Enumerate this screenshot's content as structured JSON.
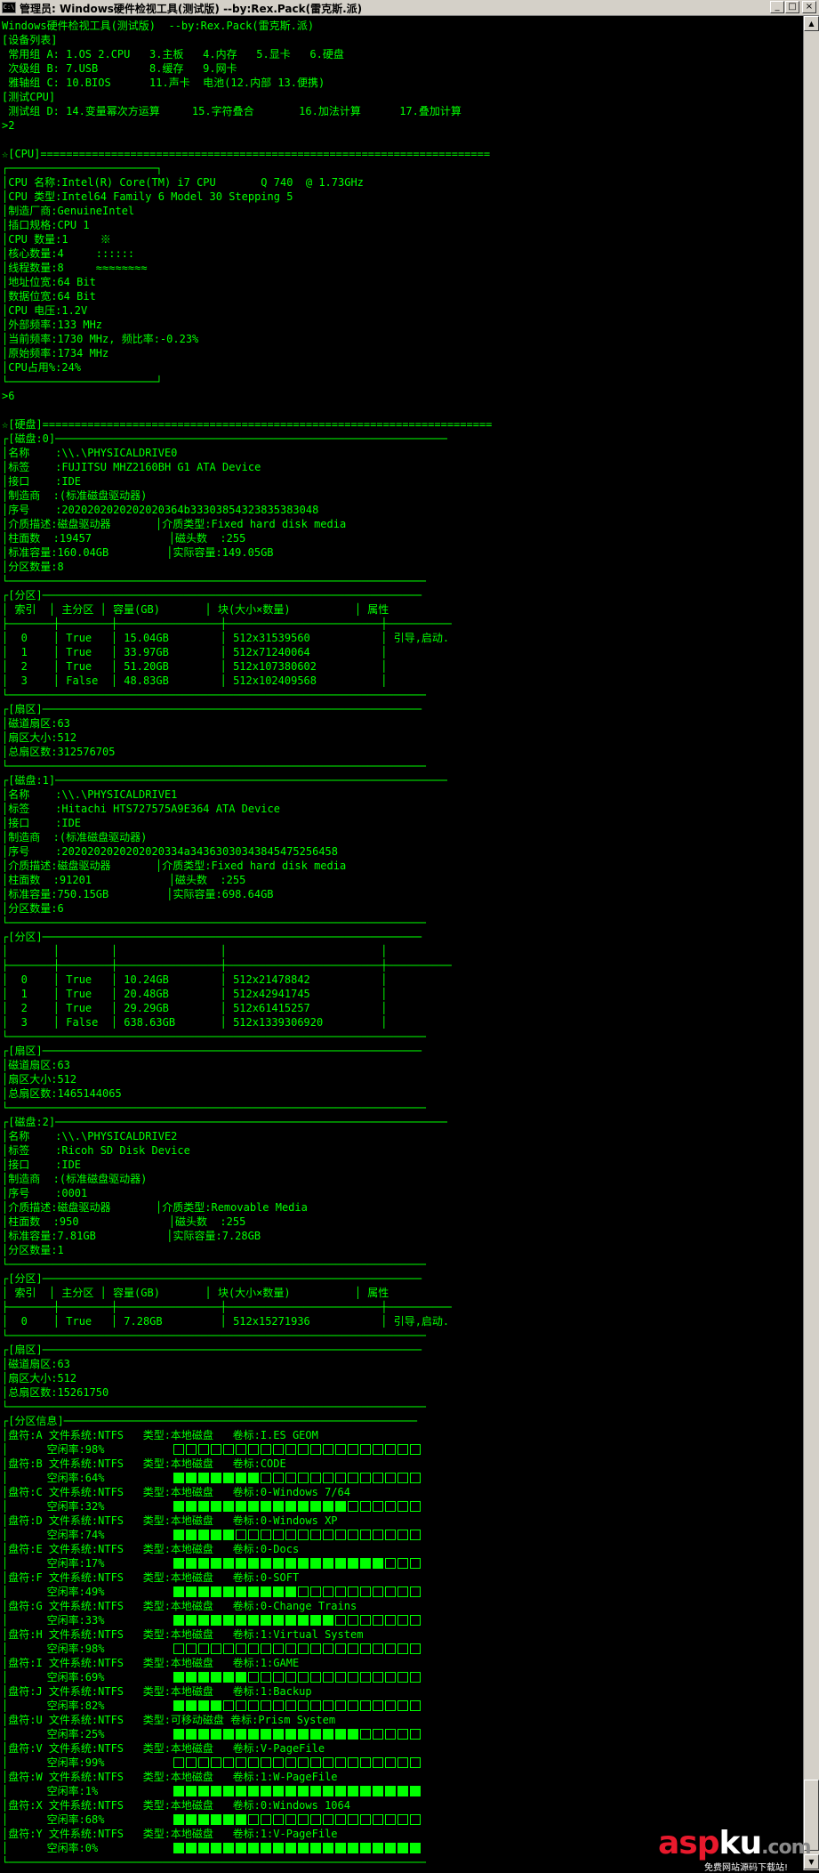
{
  "window": {
    "icon": "C:\\",
    "title": "管理员:  Windows硬件检视工具(测试版)  --by:Rex.Pack(雷克斯.派)",
    "minimize": "_",
    "maximize": "□",
    "close": "×"
  },
  "scrollbar": {
    "up": "▲",
    "down": "▼"
  },
  "console_lines": [
    "Windows硬件检视工具(测试版)  --by:Rex.Pack(雷克斯.派)",
    "[设备列表]",
    " 常用组 A: 1.OS 2.CPU   3.主板   4.内存   5.显卡   6.硬盘",
    " 次级组 B: 7.USB        8.缓存   9.网卡",
    " 雅轴组 C: 10.BIOS      11.声卡  电池(12.内部 13.便携)",
    "[测试CPU]",
    " 测试组 D: 14.变量幂次方运算     15.字符叠合       16.加法计算      17.叠加计算",
    ">2",
    "",
    "☆[CPU]======================================================================",
    "┌───────────────────────┐",
    "│CPU 名称:Intel(R) Core(TM) i7 CPU       Q 740  @ 1.73GHz",
    "│CPU 类型:Intel64 Family 6 Model 30 Stepping 5",
    "│制造厂商:GenuineIntel",
    "│插口规格:CPU 1",
    "│CPU 数量:1     ※",
    "│核心数量:4     ::::::",
    "│线程数量:8     ≈≈≈≈≈≈≈≈",
    "│地址位宽:64 Bit",
    "│数据位宽:64 Bit",
    "│CPU 电压:1.2V",
    "│外部频率:133 MHz",
    "│当前频率:1730 MHz, 频比率:-0.23%",
    "│原始频率:1734 MHz",
    "│CPU占用%:24%",
    "└───────────────────────┘",
    ">6",
    "",
    "☆[硬盘]======================================================================",
    "┌[磁盘:0]─────────────────────────────────────────────────────────────",
    "│名称    :\\\\.\\PHYSICALDRIVE0",
    "│标签    :FUJITSU MHZ2160BH G1 ATA Device",
    "│接口    :IDE",
    "│制造商  :(标准磁盘驱动器)",
    "│序号    :2020202020202020364b33303854323835383048",
    "│介质描述:磁盘驱动器       │介质类型:Fixed hard disk media",
    "│柱面数  :19457            │磁头数  :255",
    "│标准容量:160.04GB         │实际容量:149.05GB",
    "│分区数量:8",
    "└─────────────────────────────────────────────────────────────────",
    "┌[分区]───────────────────────────────────────────────────────────",
    "│ 索引  │ 主分区 │ 容量(GB)       │ 块(大小×数量)          │ 属性",
    "├───────┼────────┼────────────────┼────────────────────────┼──────────",
    "│  0    │ True   │ 15.04GB        │ 512x31539560           │ 引导,启动.",
    "│  1    │ True   │ 33.97GB        │ 512x71240064           │",
    "│  2    │ True   │ 51.20GB        │ 512x107380602          │",
    "│  3    │ False  │ 48.83GB        │ 512x102409568          │",
    "└─────────────────────────────────────────────────────────────────",
    "┌[扇区]───────────────────────────────────────────────────────────",
    "│磁道扇区:63",
    "│扇区大小:512",
    "│总扇区数:312576705",
    "└─────────────────────────────────────────────────────────────────",
    "┌[磁盘:1]─────────────────────────────────────────────────────────────",
    "│名称    :\\\\.\\PHYSICALDRIVE1",
    "│标签    :Hitachi HTS727575A9E364 ATA Device",
    "│接口    :IDE",
    "│制造商  :(标准磁盘驱动器)",
    "│序号    :2020202020202020334a34363030343845475256458",
    "│介质描述:磁盘驱动器       │介质类型:Fixed hard disk media",
    "│柱面数  :91201            │磁头数  :255",
    "│标准容量:750.15GB         │实际容量:698.64GB",
    "│分区数量:6",
    "└─────────────────────────────────────────────────────────────────",
    "┌[分区]───────────────────────────────────────────────────────────",
    "│       │        │                │                        │",
    "├───────┼────────┼────────────────┼────────────────────────┼──────────",
    "│  0    │ True   │ 10.24GB        │ 512x21478842           │",
    "│  1    │ True   │ 20.48GB        │ 512x42941745           │",
    "│  2    │ True   │ 29.29GB        │ 512x61415257           │",
    "│  3    │ False  │ 638.63GB       │ 512x1339306920         │",
    "└─────────────────────────────────────────────────────────────────",
    "┌[扇区]───────────────────────────────────────────────────────────",
    "│磁道扇区:63",
    "│扇区大小:512",
    "│总扇区数:1465144065",
    "└─────────────────────────────────────────────────────────────────",
    "┌[磁盘:2]─────────────────────────────────────────────────────────────",
    "│名称    :\\\\.\\PHYSICALDRIVE2",
    "│标签    :Ricoh SD Disk Device",
    "│接口    :IDE",
    "│制造商  :(标准磁盘驱动器)",
    "│序号    :0001",
    "│介质描述:磁盘驱动器       │介质类型:Removable Media",
    "│柱面数  :950              │磁头数  :255",
    "│标准容量:7.81GB           │实际容量:7.28GB",
    "│分区数量:1",
    "└─────────────────────────────────────────────────────────────────",
    "┌[分区]───────────────────────────────────────────────────────────",
    "│ 索引  │ 主分区 │ 容量(GB)       │ 块(大小×数量)          │ 属性",
    "├───────┼────────┼────────────────┼────────────────────────┼──────────",
    "│  0    │ True   │ 7.28GB         │ 512x15271936           │ 引导,启动.",
    "└─────────────────────────────────────────────────────────────────",
    "┌[扇区]───────────────────────────────────────────────────────────",
    "│磁道扇区:63",
    "│扇区大小:512",
    "│总扇区数:15261750",
    "└─────────────────────────────────────────────────────────────────",
    "┌[分区信息]───────────────────────────────────────────────────────"
  ],
  "partitions": [
    {
      "info": "│盘符:A 文件系统:NTFS   类型:本地磁盘   卷标:I.ES GEOM",
      "free": "│      空闲率:98%",
      "free_ratio": 0.98
    },
    {
      "info": "│盘符:B 文件系统:NTFS   类型:本地磁盘   卷标:CODE",
      "free": "│      空闲率:64%",
      "free_ratio": 0.64
    },
    {
      "info": "│盘符:C 文件系统:NTFS   类型:本地磁盘   卷标:0-Windows 7/64",
      "free": "│      空闲率:32%",
      "free_ratio": 0.32
    },
    {
      "info": "│盘符:D 文件系统:NTFS   类型:本地磁盘   卷标:0-Windows XP",
      "free": "│      空闲率:74%",
      "free_ratio": 0.74
    },
    {
      "info": "│盘符:E 文件系统:NTFS   类型:本地磁盘   卷标:0-Docs",
      "free": "│      空闲率:17%",
      "free_ratio": 0.17
    },
    {
      "info": "│盘符:F 文件系统:NTFS   类型:本地磁盘   卷标:0-SOFT",
      "free": "│      空闲率:49%",
      "free_ratio": 0.49
    },
    {
      "info": "│盘符:G 文件系统:NTFS   类型:本地磁盘   卷标:0-Change Trains",
      "free": "│      空闲率:33%",
      "free_ratio": 0.33
    },
    {
      "info": "│盘符:H 文件系统:NTFS   类型:本地磁盘   卷标:1:Virtual System",
      "free": "│      空闲率:98%",
      "free_ratio": 0.98
    },
    {
      "info": "│盘符:I 文件系统:NTFS   类型:本地磁盘   卷标:1:GAME",
      "free": "│      空闲率:69%",
      "free_ratio": 0.69
    },
    {
      "info": "│盘符:J 文件系统:NTFS   类型:本地磁盘   卷标:1:Backup",
      "free": "│      空闲率:82%",
      "free_ratio": 0.82
    },
    {
      "info": "│盘符:U 文件系统:NTFS   类型:可移动磁盘 卷标:Prism System",
      "free": "│      空闲率:25%",
      "free_ratio": 0.25
    },
    {
      "info": "│盘符:V 文件系统:NTFS   类型:本地磁盘   卷标:V-PageFile",
      "free": "│      空闲率:99%",
      "free_ratio": 0.99
    },
    {
      "info": "│盘符:W 文件系统:NTFS   类型:本地磁盘   卷标:1:W-PageFile",
      "free": "│      空闲率:1%",
      "free_ratio": 0.01
    },
    {
      "info": "│盘符:X 文件系统:NTFS   类型:本地磁盘   卷标:0:Windows 1064",
      "free": "│      空闲率:68%",
      "free_ratio": 0.68
    },
    {
      "info": "│盘符:Y 文件系统:NTFS   类型:本地磁盘   卷标:1:V-PageFile",
      "free": "│      空闲率:0%",
      "free_ratio": 0.0
    }
  ],
  "footer_lines": [
    "└─────────────────────────────────────────────────────────────────"
  ],
  "watermark": {
    "a": "asp",
    "b": "ku",
    "c": ".com",
    "sub": "免费网站源码下载站!"
  },
  "colors": {
    "text": "#00ff00",
    "background": "#000000"
  }
}
